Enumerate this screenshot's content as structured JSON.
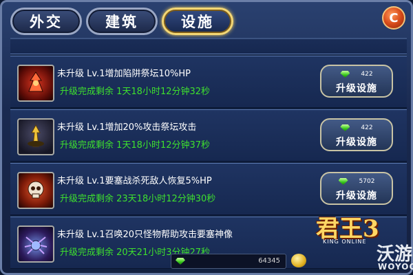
{
  "tabs": [
    {
      "label": "外交",
      "active": false
    },
    {
      "label": "建筑",
      "active": false
    },
    {
      "label": "设施",
      "active": true
    }
  ],
  "close_icon": "close-icon",
  "facilities": [
    {
      "title": "未升级  Lv.1增加陷阱祭坛10%HP",
      "timer": "升级完成剩余  1天18小时12分钟32秒",
      "cost": "422",
      "button_label": "升级设施",
      "icon": "trap-altar-icon",
      "icon_color": "#b5211a"
    },
    {
      "title": "未升级  Lv.1增加20%攻击祭坛攻击",
      "timer": "升级完成剩余  1天18小时12分钟37秒",
      "cost": "422",
      "button_label": "升级设施",
      "icon": "attack-altar-icon",
      "icon_color": "#e0b42a"
    },
    {
      "title": "未升级  Lv.1要塞战杀死敌人恢复5%HP",
      "timer": "升级完成剩余  23天18小时12分钟30秒",
      "cost": "5702",
      "button_label": "升级设施",
      "icon": "fortress-skull-icon",
      "icon_color": "#d24a2a"
    },
    {
      "title": "未升级  Lv.1召唤20只怪物帮助攻击要塞神像",
      "timer": "升级完成剩余  20天21小时3分钟27秒",
      "cost": "",
      "button_label": "",
      "icon": "summon-spider-icon",
      "icon_color": "#6a4bc4"
    }
  ],
  "currency": {
    "gems": "64345",
    "gem_icon": "green-gem-icon",
    "gold_icon": "gold-coin-icon"
  },
  "logo": {
    "text": "君王3",
    "sub": "KING ONLINE",
    "watermark_cn": "沃游",
    "watermark_en": "WOYOO"
  },
  "colors": {
    "accent_gold": "#f4d774",
    "timer_green": "#3ee02e",
    "panel_blue": "#1f3462"
  }
}
